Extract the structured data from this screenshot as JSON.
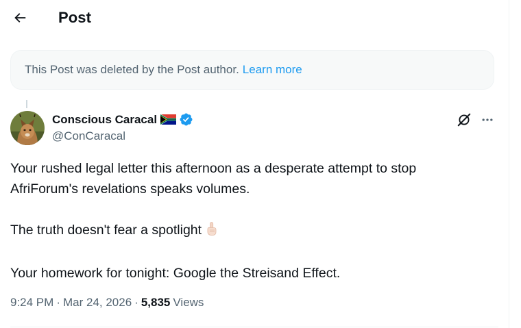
{
  "header": {
    "title": "Post",
    "back_icon": "arrow-left-icon"
  },
  "notice": {
    "text": "This Post was deleted by the Post author.",
    "link": "Learn more"
  },
  "author": {
    "name": "Conscious Caracal",
    "handle": "@ConCaracal",
    "flag": "south-africa-flag",
    "verified_icon": "verified-badge-icon",
    "verified_color": "#1d9bf0"
  },
  "tweet": {
    "line1": "Your rushed legal letter this afternoon as a desperate attempt to stop",
    "line2": "AfriForum's revelations speaks volumes.",
    "line3": "The truth doesn't fear a spotlight",
    "line3_emoji": "☝🏻",
    "line4": "Your homework for tonight: Google the Streisand Effect."
  },
  "meta": {
    "time": "9:24 PM",
    "separator": "·",
    "date": "Mar 24, 2026",
    "views_count": "5,835",
    "views_label": "Views"
  },
  "colors": {
    "text": "#0f1419",
    "secondary": "#536471",
    "link": "#1d9bf0",
    "notice_bg": "#f7f9f9"
  }
}
